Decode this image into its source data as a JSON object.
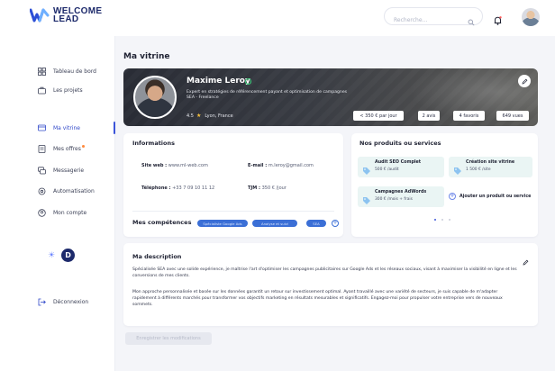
{
  "brand": {
    "line1": "WELCOME",
    "line2": "LEAD",
    "color": "#1d2a6b"
  },
  "topbar": {
    "search_placeholder": "Recherche..."
  },
  "sidebar": {
    "items": [
      {
        "label": "Tableau de bord",
        "icon": "dashboard-icon"
      },
      {
        "label": "Les projets",
        "icon": "briefcase-icon"
      },
      {
        "label": "Ma vitrine",
        "icon": "storefront-icon",
        "active": true
      },
      {
        "label": "Mes offres",
        "icon": "offers-icon",
        "badge": true
      },
      {
        "label": "Messagerie",
        "icon": "chat-icon"
      },
      {
        "label": "Automatisation",
        "icon": "automation-icon"
      },
      {
        "label": "Mon compte",
        "icon": "account-icon"
      }
    ],
    "theme_toggle": {
      "light": "☀",
      "dark": "D"
    },
    "logout": "Déconnexion",
    "accent": "#3b54d9"
  },
  "page": {
    "title": "Ma vitrine"
  },
  "profile": {
    "name": "Maxime Leroy",
    "headline": "Expert en stratégies de référencement payant et optimisation de campagnes",
    "subline": "SEA - Freelance",
    "rating": "4.5",
    "location": "Lyon, France",
    "stats": [
      "< 350 € par jour",
      "2 avis",
      "4 favoris",
      "649 vues"
    ]
  },
  "informations": {
    "title": "Informations",
    "website_label": "Site web :",
    "website_value": "www.ml-web.com",
    "email_label": "E-mail :",
    "email_value": "m.leroy@gmail.com",
    "phone_label": "Téléphone :",
    "phone_value": "+33 7 09 10 11 12",
    "tjm_label": "TJM :",
    "tjm_value": "350 € /jour"
  },
  "skills": {
    "title": "Mes compétences",
    "items": [
      "Spécialiste Google Ads",
      "Analyse et suivi",
      "SEA"
    ]
  },
  "products": {
    "title": "Nos produits ou services",
    "items": [
      {
        "name": "Audit SEO Complet",
        "price": "500 € /audit"
      },
      {
        "name": "Création site vitrine",
        "price": "1 500 € /site"
      },
      {
        "name": "Campagnes AdWords",
        "price": "300 € /mois + frais"
      }
    ],
    "add_label": "Ajouter un produit ou service",
    "carousel_pages": 3,
    "carousel_active": 1
  },
  "description": {
    "title": "Ma description",
    "paragraph1": "Spécialisée SEA avec une solide expérience, je maîtrise l'art d'optimiser les campagnes publicitaires sur Google Ads et les réseaux sociaux, visant à maximiser la visibilité en ligne et les conversions de mes clients.",
    "paragraph2": "Mon approche personnalisée et basée sur les données garantit un retour sur investissement optimal. Ayant travaillé avec une variété de secteurs, je suis capable de m'adapter rapidement à différents marchés pour transformer vos objectifs marketing en résultats mesurables et significatifs. Engagez-moi pour propulser votre entreprise vers de nouveaux sommets."
  },
  "actions": {
    "save_label": "Enregistrer les modifications"
  }
}
